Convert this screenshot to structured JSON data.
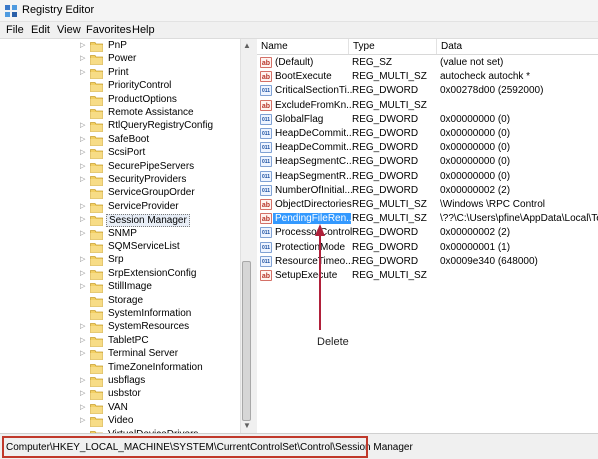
{
  "window": {
    "title": "Registry Editor"
  },
  "menu": {
    "items": [
      "File",
      "Edit",
      "View",
      "Favorites",
      "Help"
    ]
  },
  "tree": {
    "items": [
      {
        "label": "PnP",
        "expandable": true
      },
      {
        "label": "Power",
        "expandable": true
      },
      {
        "label": "Print",
        "expandable": true
      },
      {
        "label": "PriorityControl",
        "expandable": false
      },
      {
        "label": "ProductOptions",
        "expandable": false
      },
      {
        "label": "Remote Assistance",
        "expandable": false
      },
      {
        "label": "RtlQueryRegistryConfig",
        "expandable": true
      },
      {
        "label": "SafeBoot",
        "expandable": true
      },
      {
        "label": "ScsiPort",
        "expandable": true
      },
      {
        "label": "SecurePipeServers",
        "expandable": true
      },
      {
        "label": "SecurityProviders",
        "expandable": true
      },
      {
        "label": "ServiceGroupOrder",
        "expandable": false
      },
      {
        "label": "ServiceProvider",
        "expandable": true
      },
      {
        "label": "Session Manager",
        "expandable": true,
        "selected": true
      },
      {
        "label": "SNMP",
        "expandable": true
      },
      {
        "label": "SQMServiceList",
        "expandable": false
      },
      {
        "label": "Srp",
        "expandable": true
      },
      {
        "label": "SrpExtensionConfig",
        "expandable": true
      },
      {
        "label": "StillImage",
        "expandable": true
      },
      {
        "label": "Storage",
        "expandable": false
      },
      {
        "label": "SystemInformation",
        "expandable": false
      },
      {
        "label": "SystemResources",
        "expandable": true
      },
      {
        "label": "TabletPC",
        "expandable": true
      },
      {
        "label": "Terminal Server",
        "expandable": true
      },
      {
        "label": "TimeZoneInformation",
        "expandable": false
      },
      {
        "label": "usbflags",
        "expandable": true
      },
      {
        "label": "usbstor",
        "expandable": true
      },
      {
        "label": "VAN",
        "expandable": true
      },
      {
        "label": "Video",
        "expandable": true
      },
      {
        "label": "VirtualDeviceDrivers",
        "expandable": false
      }
    ]
  },
  "list": {
    "columns": {
      "name": "Name",
      "type": "Type",
      "data": "Data"
    },
    "rows": [
      {
        "icon": "ab",
        "name": "(Default)",
        "type": "REG_SZ",
        "data": "(value not set)"
      },
      {
        "icon": "ab",
        "name": "BootExecute",
        "type": "REG_MULTI_SZ",
        "data": "autocheck autochk *"
      },
      {
        "icon": "bin",
        "name": "CriticalSectionTi...",
        "type": "REG_DWORD",
        "data": "0x00278d00 (2592000)"
      },
      {
        "icon": "ab",
        "name": "ExcludeFromKn...",
        "type": "REG_MULTI_SZ",
        "data": ""
      },
      {
        "icon": "bin",
        "name": "GlobalFlag",
        "type": "REG_DWORD",
        "data": "0x00000000 (0)"
      },
      {
        "icon": "bin",
        "name": "HeapDeCommit...",
        "type": "REG_DWORD",
        "data": "0x00000000 (0)"
      },
      {
        "icon": "bin",
        "name": "HeapDeCommit...",
        "type": "REG_DWORD",
        "data": "0x00000000 (0)"
      },
      {
        "icon": "bin",
        "name": "HeapSegmentC...",
        "type": "REG_DWORD",
        "data": "0x00000000 (0)"
      },
      {
        "icon": "bin",
        "name": "HeapSegmentR...",
        "type": "REG_DWORD",
        "data": "0x00000000 (0)"
      },
      {
        "icon": "bin",
        "name": "NumberOfInitial...",
        "type": "REG_DWORD",
        "data": "0x00000002 (2)"
      },
      {
        "icon": "ab",
        "name": "ObjectDirectories",
        "type": "REG_MULTI_SZ",
        "data": "\\Windows \\RPC Control"
      },
      {
        "icon": "ab",
        "name": "PendingFileRen...",
        "type": "REG_MULTI_SZ",
        "data": "\\??\\C:\\Users\\pfine\\AppData\\Local\\Temp",
        "highlighted": true
      },
      {
        "icon": "bin",
        "name": "ProcessorControl",
        "type": "REG_DWORD",
        "data": "0x00000002 (2)"
      },
      {
        "icon": "bin",
        "name": "ProtectionMode",
        "type": "REG_DWORD",
        "data": "0x00000001 (1)"
      },
      {
        "icon": "bin",
        "name": "ResourceTimeo...",
        "type": "REG_DWORD",
        "data": "0x0009e340 (648000)"
      },
      {
        "icon": "ab",
        "name": "SetupExecute",
        "type": "REG_MULTI_SZ",
        "data": ""
      }
    ]
  },
  "annotation": {
    "label": "Delete",
    "color": "#b0203a"
  },
  "status": {
    "path": "Computer\\HKEY_LOCAL_MACHINE\\SYSTEM\\CurrentControlSet\\Control\\Session Manager"
  },
  "colors": {
    "selection": "#3399ff",
    "status_outline": "#c0392b"
  }
}
